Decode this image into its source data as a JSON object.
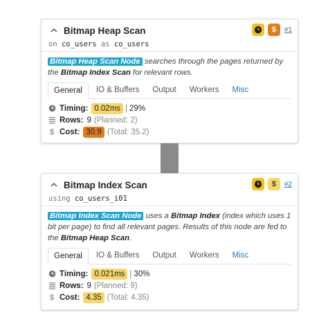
{
  "nodes": [
    {
      "title": "Bitmap Heap Scan",
      "subtitle_prefix": "on",
      "relation": "co_users",
      "subtitle_kw2": "as",
      "alias": "co_users",
      "link": "#1",
      "desc_tag": "Bitmap Heap Scan Node",
      "desc_text1": " searches through the pages returned by the ",
      "desc_bold": "Bitmap Index Scan",
      "desc_text2": " for relevant rows.",
      "tabs": [
        "General",
        "IO & Buffers",
        "Output",
        "Workers",
        "Misc"
      ],
      "timing_label": "Timing:",
      "timing_value": "0.02ms",
      "timing_pct": "29%",
      "rows_label": "Rows:",
      "rows_value": "9",
      "rows_planned": "(Planned: 2)",
      "cost_label": "Cost:",
      "cost_value": "30.9",
      "cost_total": "(Total: 35.2)"
    },
    {
      "title": "Bitmap Index Scan",
      "subtitle_prefix": "using",
      "index": "co_users_i01",
      "link": "#2",
      "desc_tag": "Bitmap Index Scan Node",
      "desc_text1": " uses a ",
      "desc_bold1": "Bitmap Index",
      "desc_text2": " (index which uses 1 bit per page) to find all relevant pages. Results of this node are fed to the ",
      "desc_bold2": "Bitmap Heap Scan",
      "desc_text3": ".",
      "tabs": [
        "General",
        "IO & Buffers",
        "Output",
        "Workers",
        "Misc"
      ],
      "timing_label": "Timing:",
      "timing_value": "0.021ms",
      "timing_pct": "30%",
      "rows_label": "Rows:",
      "rows_value": "9",
      "rows_planned": "(Planned: 9)",
      "cost_label": "Cost:",
      "cost_value": "4.35",
      "cost_total": "(Total: 4.35)"
    }
  ],
  "separator": "|",
  "icons": {
    "collapse": "chevron-up-icon",
    "clock": "clock-icon",
    "dollar": "dollar-icon",
    "timing": "clock-icon",
    "rows": "rows-icon",
    "cost": "dollar-icon"
  },
  "colors": {
    "tag": "#1ba6cf",
    "clock_badge": "#f0c419",
    "cost_high": "#e07d1a",
    "cost_low": "#f6d768",
    "link": "#2a7ab0",
    "connector": "#8a8a8a"
  }
}
